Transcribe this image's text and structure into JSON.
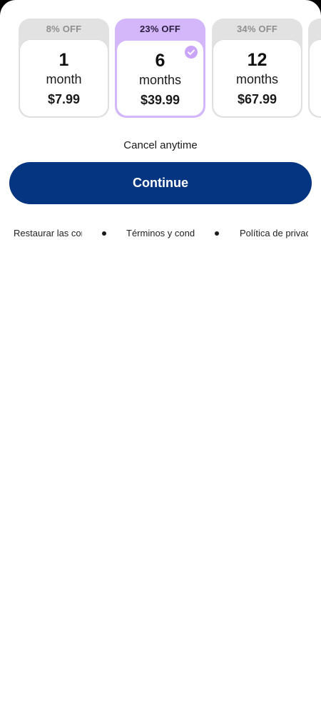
{
  "plans": [
    {
      "discount": "8% OFF",
      "count": "1",
      "unit": "month",
      "price": "$7.99",
      "selected": false
    },
    {
      "discount": "23% OFF",
      "count": "6",
      "unit": "months",
      "price": "$39.99",
      "selected": true
    },
    {
      "discount": "34% OFF",
      "count": "12",
      "unit": "months",
      "price": "$67.99",
      "selected": false
    }
  ],
  "cancel_text": "Cancel anytime",
  "continue_label": "Continue",
  "links": {
    "restore": "Restaurar las compras",
    "terms": "Términos y condiciones",
    "privacy": "Política de privacidad"
  },
  "colors": {
    "primary": "#053580",
    "selected_accent": "#d4b6fb",
    "badge_gray": "#e2e2e2"
  },
  "icons": {
    "selected_check": "checkmark-circle-icon",
    "separator": "bullet"
  }
}
